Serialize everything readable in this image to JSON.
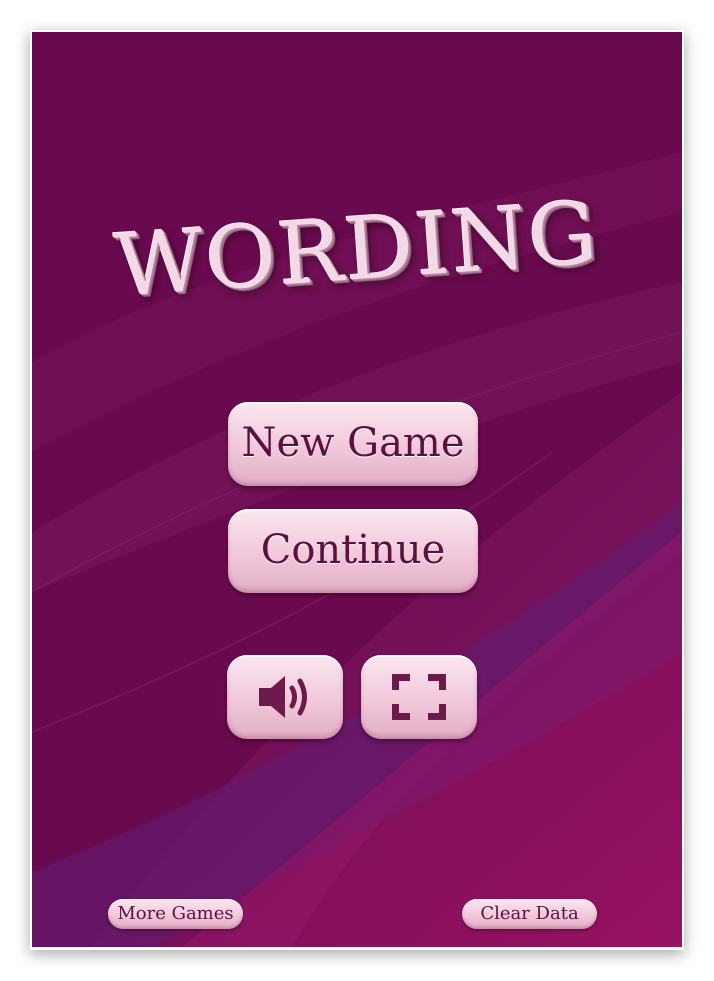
{
  "game": {
    "title": "WORDING",
    "buttons": {
      "new_game": "New Game",
      "continue": "Continue",
      "sound_icon": "speaker-icon",
      "fullscreen_icon": "fullscreen-icon",
      "more_games": "More Games",
      "clear_data": "Clear Data"
    },
    "colors": {
      "background": "#6a0a4e",
      "accent": "#a0156a",
      "button_face": "#f1c8da",
      "button_text": "#5a1140"
    }
  }
}
